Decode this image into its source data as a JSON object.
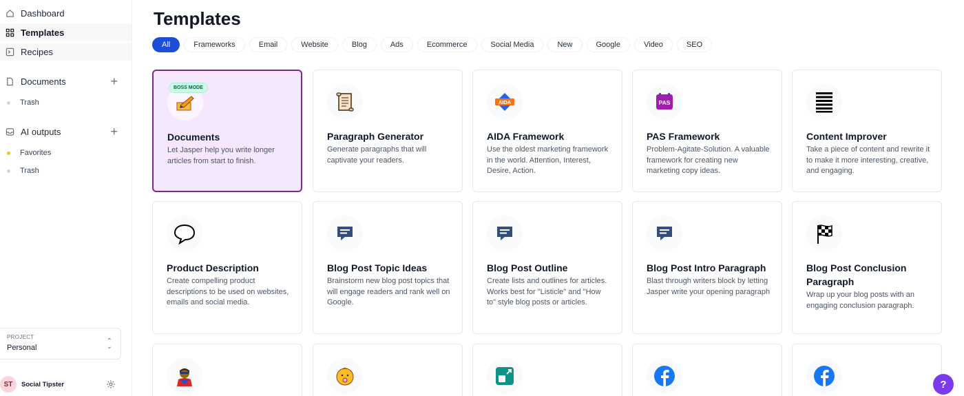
{
  "sidebar": {
    "nav": [
      {
        "label": "Dashboard",
        "icon": "home-icon"
      },
      {
        "label": "Templates",
        "icon": "grid-icon"
      },
      {
        "label": "Recipes",
        "icon": "recipe-icon"
      }
    ],
    "documents": {
      "label": "Documents",
      "icon": "document-icon",
      "trash": "Trash"
    },
    "ai_outputs": {
      "label": "AI outputs",
      "icon": "inbox-icon",
      "favorites": "Favorites",
      "trash": "Trash"
    },
    "project": {
      "label": "PROJECT",
      "value": "Personal"
    },
    "user": {
      "initials": "ST",
      "name": "Social Tipster"
    }
  },
  "main": {
    "title": "Templates",
    "tabs": [
      "All",
      "Frameworks",
      "Email",
      "Website",
      "Blog",
      "Ads",
      "Ecommerce",
      "Social Media",
      "New",
      "Google",
      "Video",
      "SEO"
    ],
    "active_tab": "All",
    "cards": [
      {
        "title": "Documents",
        "desc": "Let Jasper help you write longer articles from start to finish.",
        "badge": "BOSS MODE",
        "icon": "writing-hand-icon"
      },
      {
        "title": "Paragraph Generator",
        "desc": "Generate paragraphs that will captivate your readers.",
        "icon": "scroll-icon"
      },
      {
        "title": "AIDA Framework",
        "desc": "Use the oldest marketing framework in the world. Attention, Interest, Desire, Action.",
        "icon": "aida-icon",
        "icon_text": "AIDA"
      },
      {
        "title": "PAS Framework",
        "desc": "Problem-Agitate-Solution. A valuable framework for creating new marketing copy ideas.",
        "icon": "pas-icon",
        "icon_text": "PAS"
      },
      {
        "title": "Content Improver",
        "desc": "Take a piece of content and rewrite it to make it more interesting, creative, and engaging.",
        "icon": "lines-icon"
      },
      {
        "title": "Product Description",
        "desc": "Create compelling product descriptions to be used on websites, emails and social media.",
        "icon": "speech-bubble-icon"
      },
      {
        "title": "Blog Post Topic Ideas",
        "desc": "Brainstorm new blog post topics that will engage readers and rank well on Google.",
        "icon": "chat-icon"
      },
      {
        "title": "Blog Post Outline",
        "desc": "Create lists and outlines for articles. Works best for \"Listicle\" and \"How to\" style blog posts or articles.",
        "icon": "chat-icon"
      },
      {
        "title": "Blog Post Intro Paragraph",
        "desc": "Blast through writers block by letting Jasper write your opening paragraph",
        "icon": "chat-icon"
      },
      {
        "title": "Blog Post Conclusion Paragraph",
        "desc": "Wrap up your blog posts with an engaging conclusion paragraph.",
        "icon": "checkered-flag-icon"
      },
      {
        "title": "",
        "desc": "",
        "icon": "superhero-icon"
      },
      {
        "title": "",
        "desc": "",
        "icon": "baby-icon"
      },
      {
        "title": "",
        "desc": "",
        "icon": "app-icon"
      },
      {
        "title": "",
        "desc": "",
        "icon": "facebook-icon"
      },
      {
        "title": "",
        "desc": "",
        "icon": "facebook-icon"
      }
    ]
  },
  "help": {
    "label": "?"
  },
  "colors": {
    "accent": "#1d4ed8",
    "selected_border": "#7b2a8c",
    "selected_bg": "#f5e8fe",
    "help_bg": "#7c3aed",
    "facebook": "#1877f2"
  }
}
